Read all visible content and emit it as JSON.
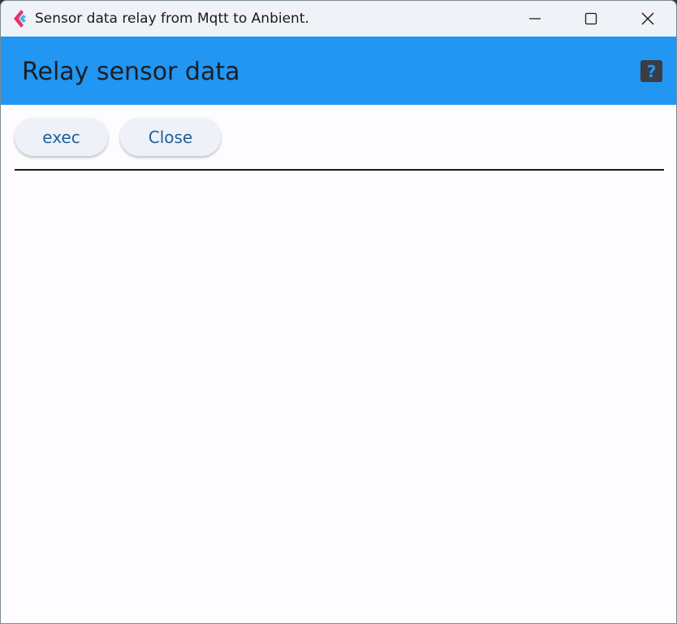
{
  "window": {
    "title": "Sensor data relay from Mqtt to Anbient."
  },
  "appbar": {
    "title": "Relay sensor data",
    "help_symbol": "?"
  },
  "actions": {
    "exec_label": "exec",
    "close_label": "Close"
  },
  "colors": {
    "appbar": "#2196f3",
    "button_text": "#1f5f98",
    "background": "#fdfdff"
  },
  "icons": {
    "app": "flutter-logo-icon",
    "minimize": "minimize-icon",
    "maximize": "maximize-icon",
    "close": "close-icon",
    "help": "help-icon"
  }
}
